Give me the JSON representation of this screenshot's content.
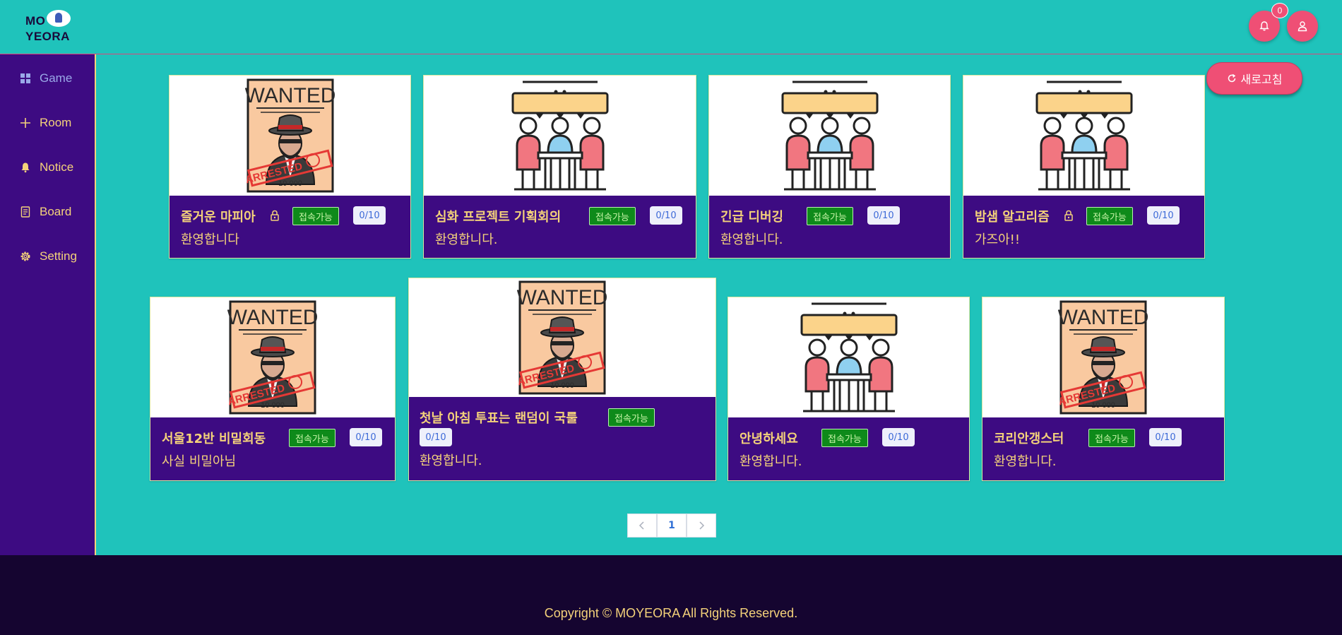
{
  "header": {
    "logo_line1": "MO",
    "logo_line2": "YEORA",
    "notification_count": "0"
  },
  "sidebar": {
    "items": [
      {
        "label": "Game",
        "icon": "grid-icon"
      },
      {
        "label": "Room",
        "icon": "plus-icon"
      },
      {
        "label": "Notice",
        "icon": "bell-icon"
      },
      {
        "label": "Board",
        "icon": "document-icon"
      },
      {
        "label": "Setting",
        "icon": "gear-icon"
      }
    ]
  },
  "toolbar": {
    "refresh_label": "새로고침"
  },
  "rooms": [
    {
      "title": "즐거운 마피아",
      "locked": true,
      "status": "접속가능",
      "count": "0/10",
      "desc": "환영합니다",
      "image": "wanted-poster"
    },
    {
      "title": "심화 프로젝트 기획회의",
      "locked": false,
      "status": "접속가능",
      "count": "0/10",
      "desc": "환영합니다.",
      "image": "meeting"
    },
    {
      "title": "긴급 디버깅",
      "locked": false,
      "status": "접속가능",
      "count": "0/10",
      "desc": "환영합니다.",
      "image": "meeting"
    },
    {
      "title": "밤샘 알고리즘",
      "locked": true,
      "status": "접속가능",
      "count": "0/10",
      "desc": "가즈아!!",
      "image": "meeting"
    },
    {
      "title": "서울12반 비밀회동",
      "locked": false,
      "status": "접속가능",
      "count": "0/10",
      "desc": "사실 비밀아님",
      "image": "wanted-poster"
    },
    {
      "title": "첫날 아침 투표는 랜덤이 국룰",
      "locked": false,
      "status": "접속가능",
      "count": "0/10",
      "desc": "환영합니다.",
      "image": "wanted-poster"
    },
    {
      "title": "안녕하세요",
      "locked": false,
      "status": "접속가능",
      "count": "0/10",
      "desc": "환영합니다.",
      "image": "meeting"
    },
    {
      "title": "코리안갱스터",
      "locked": false,
      "status": "접속가능",
      "count": "0/10",
      "desc": "환영합니다.",
      "image": "wanted-poster"
    }
  ],
  "poster_text": {
    "wanted": "WANTED",
    "reward": "10 000",
    "stamp": "ARRESTED"
  },
  "pagination": {
    "current": "1",
    "prev_icon": "chevron-left-icon",
    "next_icon": "chevron-right-icon"
  },
  "footer": {
    "copyright": "Copyright © MOYEORA All Rights Reserved."
  },
  "colors": {
    "background": "#1fc3bb",
    "sidebar": "#3d0b82",
    "accent": "#ef4f75",
    "text_gold": "#f4d27a",
    "footer": "#150530"
  }
}
